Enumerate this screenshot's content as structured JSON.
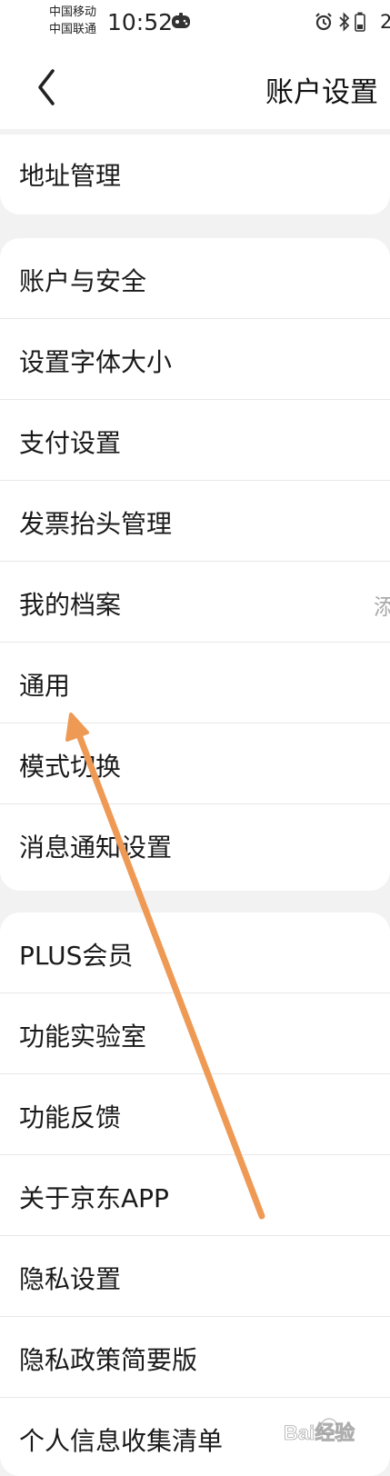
{
  "status_bar": {
    "carrier_1": "中国移动",
    "carrier_2": "中国联通",
    "time": "10:52",
    "battery": "2",
    "icons": [
      "game-controller-icon",
      "alarm-icon",
      "bluetooth-icon",
      "battery-icon"
    ]
  },
  "header": {
    "back_icon": "chevron-left-icon",
    "title": "账户设置"
  },
  "sections": {
    "s1": [
      {
        "label": "地址管理"
      }
    ],
    "s2": [
      {
        "label": "账户与安全"
      },
      {
        "label": "设置字体大小"
      },
      {
        "label": "支付设置"
      },
      {
        "label": "发票抬头管理"
      },
      {
        "label": "我的档案",
        "value": "添"
      },
      {
        "label": "通用"
      },
      {
        "label": "模式切换"
      },
      {
        "label": "消息通知设置"
      }
    ],
    "s3": [
      {
        "label": "PLUS会员"
      },
      {
        "label": "功能实验室"
      },
      {
        "label": "功能反馈"
      },
      {
        "label": "关于京东APP"
      },
      {
        "label": "隐私设置"
      },
      {
        "label": "隐私政策简要版"
      },
      {
        "label": "个人信息收集清单"
      }
    ]
  },
  "colors": {
    "background": "#f2f2f2",
    "card": "#ffffff",
    "annotation_arrow": "#ee9a55"
  },
  "watermark": {
    "text": "Bai经验"
  }
}
